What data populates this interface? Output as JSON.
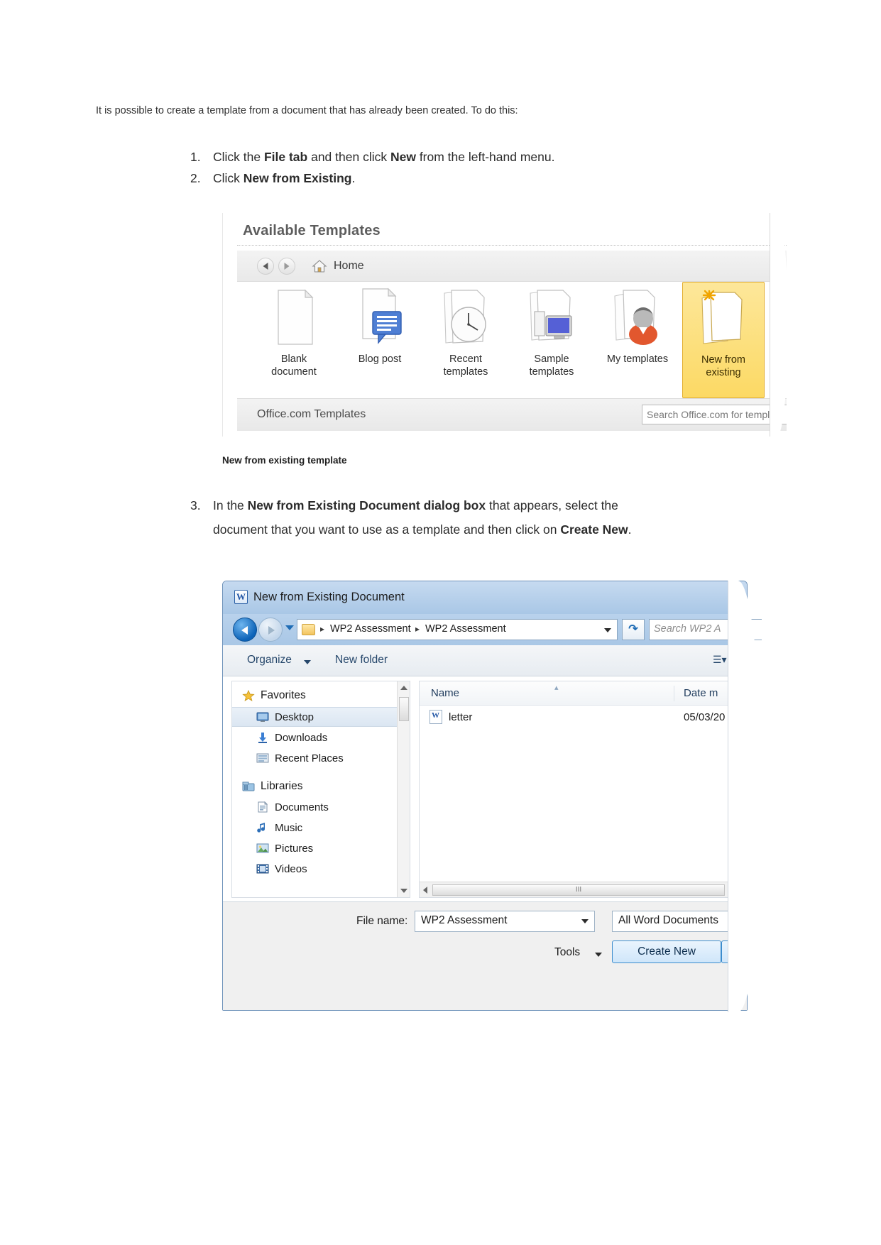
{
  "document": {
    "intro": "It is possible to create a template from a document that has already been created. To do this:",
    "steps": [
      {
        "num": "1.",
        "parts": [
          {
            "t": "Click the ",
            "b": false
          },
          {
            "t": "File tab",
            "b": true
          },
          {
            "t": " and then click ",
            "b": false
          },
          {
            "t": "New",
            "b": true
          },
          {
            "t": " from the left-hand menu.",
            "b": false
          }
        ]
      },
      {
        "num": "2.",
        "parts": [
          {
            "t": "Click ",
            "b": false
          },
          {
            "t": "New from Existing",
            "b": true
          },
          {
            "t": ".",
            "b": false
          }
        ]
      }
    ],
    "figure1_caption": "New from existing template",
    "steps2": [
      {
        "num": "3.",
        "parts": [
          {
            "t": "In the ",
            "b": false
          },
          {
            "t": "New from Existing Document dialog box",
            "b": true
          },
          {
            "t": " that appears, select the document that you want to use as a template and then click on ",
            "b": false
          },
          {
            "t": "Create New",
            "b": true
          },
          {
            "t": ".",
            "b": false
          }
        ]
      }
    ]
  },
  "templates_figure": {
    "title": "Available Templates",
    "breadcrumb_label": "Home",
    "back_icon": "back-arrow-icon",
    "forward_icon": "forward-arrow-icon",
    "home_icon": "home-icon",
    "tiles": [
      {
        "label_line1": "Blank",
        "label_line2": "document",
        "icon": "blank-document-icon",
        "selected": false
      },
      {
        "label_line1": "Blog post",
        "label_line2": "",
        "icon": "blog-post-icon",
        "selected": false
      },
      {
        "label_line1": "Recent",
        "label_line2": "templates",
        "icon": "recent-templates-icon",
        "selected": false
      },
      {
        "label_line1": "Sample",
        "label_line2": "templates",
        "icon": "sample-templates-icon",
        "selected": false
      },
      {
        "label_line1": "My templates",
        "label_line2": "",
        "icon": "my-templates-icon",
        "selected": false
      },
      {
        "label_line1": "New from",
        "label_line2": "existing",
        "icon": "new-from-existing-icon",
        "selected": true
      }
    ],
    "footer_label": "Office.com Templates",
    "search_placeholder": "Search Office.com for templat",
    "highlight_color": "#fcd964"
  },
  "dialog": {
    "title": "New from Existing Document",
    "app_icon": "word-icon",
    "address": {
      "folder_icon": "folder-icon",
      "crumbs": [
        "WP2 Assessment",
        "WP2 Assessment"
      ],
      "separator": "▸",
      "dropdown_icon": "chevron-down-icon",
      "refresh_icon": "refresh-icon",
      "search_placeholder": "Search WP2 A"
    },
    "toolbar": {
      "organize_label": "Organize",
      "new_folder_label": "New folder",
      "views_icon": "view-options-icon"
    },
    "nav_pane": [
      {
        "label": "Favorites",
        "icon": "star-icon",
        "group": true,
        "selected": false
      },
      {
        "label": "Desktop",
        "icon": "desktop-icon",
        "group": false,
        "selected": true
      },
      {
        "label": "Downloads",
        "icon": "downloads-icon",
        "group": false,
        "selected": false
      },
      {
        "label": "Recent Places",
        "icon": "recent-places-icon",
        "group": false,
        "selected": false
      },
      {
        "label": "Libraries",
        "icon": "libraries-icon",
        "group": true,
        "selected": false
      },
      {
        "label": "Documents",
        "icon": "documents-icon",
        "group": false,
        "selected": false
      },
      {
        "label": "Music",
        "icon": "music-icon",
        "group": false,
        "selected": false
      },
      {
        "label": "Pictures",
        "icon": "pictures-icon",
        "group": false,
        "selected": false
      },
      {
        "label": "Videos",
        "icon": "videos-icon",
        "group": false,
        "selected": false
      }
    ],
    "file_list": {
      "columns": [
        "Name",
        "Date m"
      ],
      "rows": [
        {
          "name": "letter",
          "date": "05/03/20",
          "icon": "word-document-icon"
        }
      ],
      "sort_indicator": "▴",
      "hscroll_grip": "III"
    },
    "footer": {
      "file_name_label": "File name:",
      "file_name_value": "WP2 Assessment",
      "file_type_value": "All Word Documents",
      "tools_label": "Tools",
      "create_label": "Create New",
      "dropdown_icon": "chevron-down-icon"
    }
  }
}
